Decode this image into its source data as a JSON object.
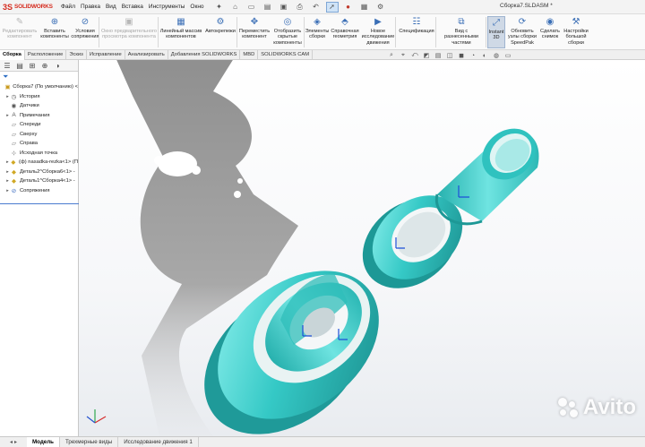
{
  "app": {
    "logo_mark": "3S",
    "logo_text": "SOLIDWORKS",
    "document_title": "Сборка7.SLDASM *"
  },
  "menu": [
    "Файл",
    "Правка",
    "Вид",
    "Вставка",
    "Инструменты",
    "Окно"
  ],
  "ribbon": {
    "buttons": [
      {
        "label": "Редактировать\nкомпонент",
        "disabled": true,
        "icon": "edit-component-icon"
      },
      {
        "label": "Вставить\nкомпоненты",
        "disabled": false,
        "icon": "insert-components-icon"
      },
      {
        "label": "Условия\nсопряжения",
        "disabled": false,
        "icon": "mate-icon"
      },
      {
        "label": "Окно предварительного\nпросмотра компонента",
        "disabled": true,
        "icon": "component-preview-icon"
      },
      {
        "label": "Линейный массив\nкомпонентов",
        "disabled": false,
        "icon": "linear-pattern-icon"
      },
      {
        "label": "Автокрепежи",
        "disabled": false,
        "icon": "smart-fasteners-icon"
      },
      {
        "label": "Переместить\nкомпонент",
        "disabled": false,
        "icon": "move-component-icon"
      },
      {
        "label": "Отобразить\nскрытые\nкомпоненты",
        "disabled": false,
        "icon": "show-hidden-icon"
      },
      {
        "label": "Элементы\nсборки",
        "disabled": false,
        "icon": "assembly-features-icon"
      },
      {
        "label": "Справочная\nгеометрия",
        "disabled": false,
        "icon": "reference-geometry-icon"
      },
      {
        "label": "Новое\nисследование\nдвижения",
        "disabled": false,
        "icon": "motion-study-icon"
      },
      {
        "label": "Спецификация",
        "disabled": false,
        "icon": "bom-icon"
      },
      {
        "label": "Вид с разнесенными\nчастями",
        "disabled": false,
        "icon": "exploded-view-icon"
      },
      {
        "label": "Instant\n3D",
        "disabled": false,
        "icon": "instant3d-icon",
        "active": true
      },
      {
        "label": "Обновить\nузлы сборки\nSpeedPak",
        "disabled": false,
        "icon": "speedpak-icon"
      },
      {
        "label": "Сделать\nснимок",
        "disabled": false,
        "icon": "snapshot-icon"
      },
      {
        "label": "Настройки\nбольшой\nсборки",
        "disabled": false,
        "icon": "large-assembly-icon"
      }
    ]
  },
  "command_tabs": [
    "Сборка",
    "Расположение",
    "Эскиз",
    "Исправление",
    "Анализировать",
    "Добавления SOLIDWORKS",
    "MBD",
    "SOLIDWORKS CAM"
  ],
  "tree": [
    {
      "label": "Сборка7 (По умолчанию) <",
      "icon": "assembly-icon",
      "level": 0,
      "expand": ""
    },
    {
      "label": "История",
      "icon": "history-icon",
      "level": 1,
      "expand": "▸"
    },
    {
      "label": "Датчики",
      "icon": "sensors-icon",
      "level": 1,
      "expand": ""
    },
    {
      "label": "Примечания",
      "icon": "annotations-icon",
      "level": 1,
      "expand": "▸"
    },
    {
      "label": "Спереди",
      "icon": "plane-icon",
      "level": 1,
      "expand": ""
    },
    {
      "label": "Сверху",
      "icon": "plane-icon",
      "level": 1,
      "expand": ""
    },
    {
      "label": "Справа",
      "icon": "plane-icon",
      "level": 1,
      "expand": ""
    },
    {
      "label": "Исходная точка",
      "icon": "origin-icon",
      "level": 1,
      "expand": ""
    },
    {
      "label": "(ф) nasadka-rezka<1> (П",
      "icon": "part-icon",
      "level": 1,
      "expand": "▸"
    },
    {
      "label": "Деталь2^Сборка6<1> -",
      "icon": "part-icon",
      "level": 1,
      "expand": "▸"
    },
    {
      "label": "Деталь1^Сборка4<1> -",
      "icon": "part-icon",
      "level": 1,
      "expand": "▸"
    },
    {
      "label": "Сопряжения",
      "icon": "mates-icon",
      "level": 1,
      "expand": "▸"
    }
  ],
  "bottom_tabs": [
    "Модель",
    "Трехмерные виды",
    "Исследование движения 1"
  ],
  "watermark": "Avito",
  "colors": {
    "model": "#35c9c6",
    "model_dark": "#1f9a99",
    "shadow": "#9a9a9a",
    "brand": "#d52b1e"
  }
}
